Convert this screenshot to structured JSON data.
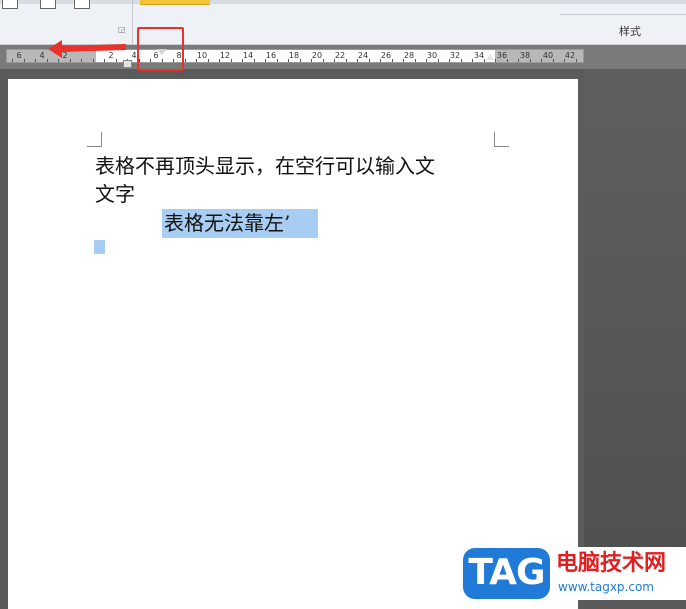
{
  "ribbon": {
    "styles_label": "样式"
  },
  "ruler": {
    "numbers": [
      "6",
      "4",
      "2",
      "2",
      "4",
      "6",
      "8",
      "10",
      "12",
      "14",
      "16",
      "18",
      "20",
      "22",
      "24",
      "26",
      "28",
      "30",
      "32",
      "34",
      "36",
      "38",
      "40",
      "42"
    ]
  },
  "document": {
    "line1": "表格不再顶头显示，在空行可以输入文",
    "line2": "文字",
    "table_cell_text": "表格无法靠左’"
  },
  "annotation": {
    "highlight_color": "#e8322b"
  },
  "watermark": {
    "logo": "TAG",
    "title": "电脑技术网",
    "url": "www.tagxp.com",
    "logo_color": "#1f7ad8",
    "title_color": "#e02020"
  }
}
